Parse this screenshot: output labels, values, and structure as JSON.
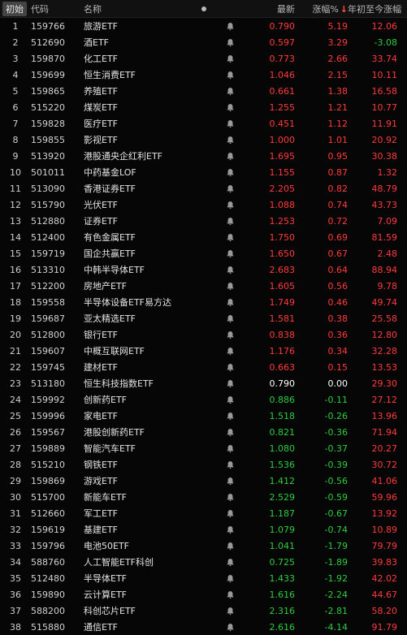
{
  "header": {
    "init": "初始",
    "code": "代码",
    "name": "名称",
    "price": "最新",
    "change": "涨幅%",
    "sort_arrow": "↓",
    "ytd": "年初至今涨幅%"
  },
  "colors": {
    "up": "#ff3b3b",
    "down": "#2ecc40",
    "flat": "#ffffff"
  },
  "rows": [
    {
      "idx": "1",
      "code": "159766",
      "name": "旅游ETF",
      "price": "0.790",
      "chg": "5.19",
      "ytd": "12.06",
      "pd": "up",
      "cd": "up",
      "yd": "up"
    },
    {
      "idx": "2",
      "code": "512690",
      "name": "酒ETF",
      "price": "0.597",
      "chg": "3.29",
      "ytd": "-3.08",
      "pd": "up",
      "cd": "up",
      "yd": "down"
    },
    {
      "idx": "3",
      "code": "159870",
      "name": "化工ETF",
      "price": "0.773",
      "chg": "2.66",
      "ytd": "33.74",
      "pd": "up",
      "cd": "up",
      "yd": "up"
    },
    {
      "idx": "4",
      "code": "159699",
      "name": "恒生消费ETF",
      "price": "1.046",
      "chg": "2.15",
      "ytd": "10.11",
      "pd": "up",
      "cd": "up",
      "yd": "up"
    },
    {
      "idx": "5",
      "code": "159865",
      "name": "养殖ETF",
      "price": "0.661",
      "chg": "1.38",
      "ytd": "16.58",
      "pd": "up",
      "cd": "up",
      "yd": "up"
    },
    {
      "idx": "6",
      "code": "515220",
      "name": "煤炭ETF",
      "price": "1.255",
      "chg": "1.21",
      "ytd": "10.77",
      "pd": "up",
      "cd": "up",
      "yd": "up"
    },
    {
      "idx": "7",
      "code": "159828",
      "name": "医疗ETF",
      "price": "0.451",
      "chg": "1.12",
      "ytd": "11.91",
      "pd": "up",
      "cd": "up",
      "yd": "up"
    },
    {
      "idx": "8",
      "code": "159855",
      "name": "影视ETF",
      "price": "1.000",
      "chg": "1.01",
      "ytd": "20.92",
      "pd": "up",
      "cd": "up",
      "yd": "up"
    },
    {
      "idx": "9",
      "code": "513920",
      "name": "港股通央企红利ETF",
      "price": "1.695",
      "chg": "0.95",
      "ytd": "30.38",
      "pd": "up",
      "cd": "up",
      "yd": "up"
    },
    {
      "idx": "10",
      "code": "501011",
      "name": "中药基金LOF",
      "price": "1.155",
      "chg": "0.87",
      "ytd": "1.32",
      "pd": "up",
      "cd": "up",
      "yd": "up"
    },
    {
      "idx": "11",
      "code": "513090",
      "name": "香港证券ETF",
      "price": "2.205",
      "chg": "0.82",
      "ytd": "48.79",
      "pd": "up",
      "cd": "up",
      "yd": "up"
    },
    {
      "idx": "12",
      "code": "515790",
      "name": "光伏ETF",
      "price": "1.088",
      "chg": "0.74",
      "ytd": "43.73",
      "pd": "up",
      "cd": "up",
      "yd": "up"
    },
    {
      "idx": "13",
      "code": "512880",
      "name": "证券ETF",
      "price": "1.253",
      "chg": "0.72",
      "ytd": "7.09",
      "pd": "up",
      "cd": "up",
      "yd": "up"
    },
    {
      "idx": "14",
      "code": "512400",
      "name": "有色金属ETF",
      "price": "1.750",
      "chg": "0.69",
      "ytd": "81.59",
      "pd": "up",
      "cd": "up",
      "yd": "up"
    },
    {
      "idx": "15",
      "code": "159719",
      "name": "国企共赢ETF",
      "price": "1.650",
      "chg": "0.67",
      "ytd": "2.48",
      "pd": "up",
      "cd": "up",
      "yd": "up"
    },
    {
      "idx": "16",
      "code": "513310",
      "name": "中韩半导体ETF",
      "price": "2.683",
      "chg": "0.64",
      "ytd": "88.94",
      "pd": "up",
      "cd": "up",
      "yd": "up"
    },
    {
      "idx": "17",
      "code": "512200",
      "name": "房地产ETF",
      "price": "1.605",
      "chg": "0.56",
      "ytd": "9.78",
      "pd": "up",
      "cd": "up",
      "yd": "up"
    },
    {
      "idx": "18",
      "code": "159558",
      "name": "半导体设备ETF易方达",
      "price": "1.749",
      "chg": "0.46",
      "ytd": "49.74",
      "pd": "up",
      "cd": "up",
      "yd": "up"
    },
    {
      "idx": "19",
      "code": "159687",
      "name": "亚太精选ETF",
      "price": "1.581",
      "chg": "0.38",
      "ytd": "25.58",
      "pd": "up",
      "cd": "up",
      "yd": "up"
    },
    {
      "idx": "20",
      "code": "512800",
      "name": "银行ETF",
      "price": "0.838",
      "chg": "0.36",
      "ytd": "12.80",
      "pd": "up",
      "cd": "up",
      "yd": "up"
    },
    {
      "idx": "21",
      "code": "159607",
      "name": "中概互联网ETF",
      "price": "1.176",
      "chg": "0.34",
      "ytd": "32.28",
      "pd": "up",
      "cd": "up",
      "yd": "up"
    },
    {
      "idx": "22",
      "code": "159745",
      "name": "建材ETF",
      "price": "0.663",
      "chg": "0.15",
      "ytd": "13.53",
      "pd": "up",
      "cd": "up",
      "yd": "up"
    },
    {
      "idx": "23",
      "code": "513180",
      "name": "恒生科技指数ETF",
      "price": "0.790",
      "chg": "0.00",
      "ytd": "29.30",
      "pd": "flat",
      "cd": "flat",
      "yd": "up"
    },
    {
      "idx": "24",
      "code": "159992",
      "name": "创新药ETF",
      "price": "0.886",
      "chg": "-0.11",
      "ytd": "27.12",
      "pd": "down",
      "cd": "down",
      "yd": "up"
    },
    {
      "idx": "25",
      "code": "159996",
      "name": "家电ETF",
      "price": "1.518",
      "chg": "-0.26",
      "ytd": "13.96",
      "pd": "down",
      "cd": "down",
      "yd": "up"
    },
    {
      "idx": "26",
      "code": "159567",
      "name": "港股创新药ETF",
      "price": "0.821",
      "chg": "-0.36",
      "ytd": "71.94",
      "pd": "down",
      "cd": "down",
      "yd": "up"
    },
    {
      "idx": "27",
      "code": "159889",
      "name": "智能汽车ETF",
      "price": "1.080",
      "chg": "-0.37",
      "ytd": "20.27",
      "pd": "down",
      "cd": "down",
      "yd": "up"
    },
    {
      "idx": "28",
      "code": "515210",
      "name": "钢铁ETF",
      "price": "1.536",
      "chg": "-0.39",
      "ytd": "30.72",
      "pd": "down",
      "cd": "down",
      "yd": "up"
    },
    {
      "idx": "29",
      "code": "159869",
      "name": "游戏ETF",
      "price": "1.412",
      "chg": "-0.56",
      "ytd": "41.06",
      "pd": "down",
      "cd": "down",
      "yd": "up"
    },
    {
      "idx": "30",
      "code": "515700",
      "name": "新能车ETF",
      "price": "2.529",
      "chg": "-0.59",
      "ytd": "59.96",
      "pd": "down",
      "cd": "down",
      "yd": "up"
    },
    {
      "idx": "31",
      "code": "512660",
      "name": "军工ETF",
      "price": "1.187",
      "chg": "-0.67",
      "ytd": "13.92",
      "pd": "down",
      "cd": "down",
      "yd": "up"
    },
    {
      "idx": "32",
      "code": "159619",
      "name": "基建ETF",
      "price": "1.079",
      "chg": "-0.74",
      "ytd": "10.89",
      "pd": "down",
      "cd": "down",
      "yd": "up"
    },
    {
      "idx": "33",
      "code": "159796",
      "name": "电池50ETF",
      "price": "1.041",
      "chg": "-1.79",
      "ytd": "79.79",
      "pd": "down",
      "cd": "down",
      "yd": "up"
    },
    {
      "idx": "34",
      "code": "588760",
      "name": "人工智能ETF科创",
      "price": "0.725",
      "chg": "-1.89",
      "ytd": "39.83",
      "pd": "down",
      "cd": "down",
      "yd": "up"
    },
    {
      "idx": "35",
      "code": "512480",
      "name": "半导体ETF",
      "price": "1.433",
      "chg": "-1.92",
      "ytd": "42.02",
      "pd": "down",
      "cd": "down",
      "yd": "up"
    },
    {
      "idx": "36",
      "code": "159890",
      "name": "云计算ETF",
      "price": "1.616",
      "chg": "-2.24",
      "ytd": "44.67",
      "pd": "down",
      "cd": "down",
      "yd": "up"
    },
    {
      "idx": "37",
      "code": "588200",
      "name": "科创芯片ETF",
      "price": "2.316",
      "chg": "-2.81",
      "ytd": "58.20",
      "pd": "down",
      "cd": "down",
      "yd": "up"
    },
    {
      "idx": "38",
      "code": "515880",
      "name": "通信ETF",
      "price": "2.616",
      "chg": "-4.14",
      "ytd": "91.79",
      "pd": "down",
      "cd": "down",
      "yd": "up"
    }
  ]
}
